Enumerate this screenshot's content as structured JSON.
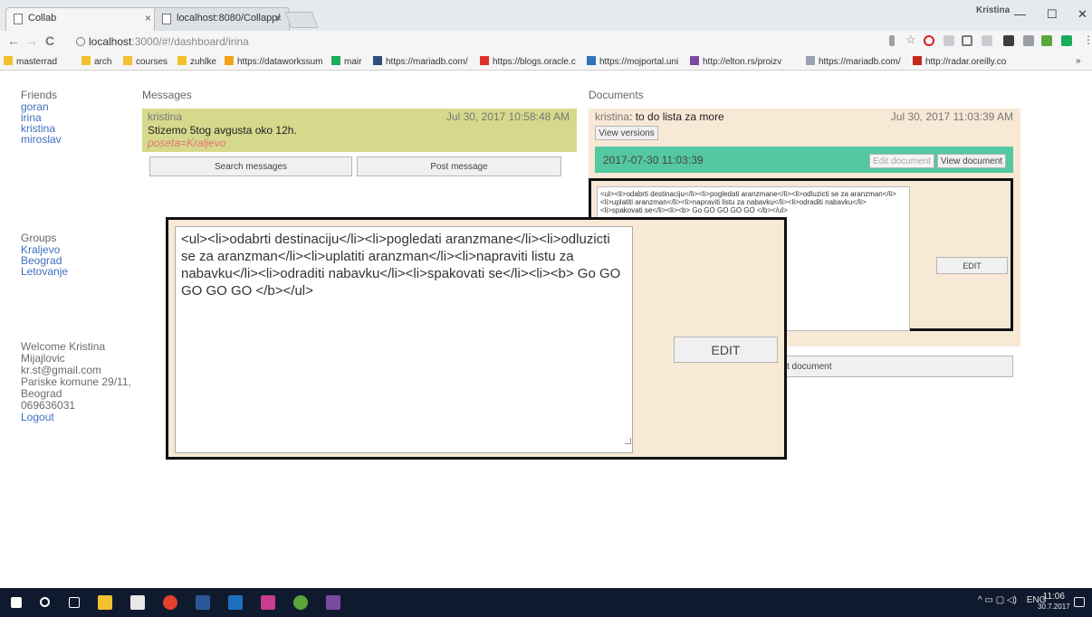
{
  "browser": {
    "tabs": [
      {
        "title": "Collab",
        "close": "×"
      },
      {
        "title": "localhost:8080/Collapp/",
        "close": "×"
      }
    ],
    "profile": "Kristina",
    "window_controls": {
      "minimize": "—",
      "maximize": "☐",
      "close": "✕"
    },
    "nav": {
      "back": "←",
      "forward": "→",
      "reload": "C"
    },
    "url": {
      "host": "localhost",
      "path": ":3000/#!/dashboard/irina"
    },
    "bookmarks": [
      {
        "label": "masterrad",
        "icon": "folder-icon",
        "color": "#f2c12e"
      },
      {
        "label": "arch",
        "icon": "folder-icon",
        "color": "#f2c12e"
      },
      {
        "label": "courses",
        "icon": "folder-icon",
        "color": "#f2c12e"
      },
      {
        "label": "zuhlke",
        "icon": "folder-icon",
        "color": "#f2c12e"
      },
      {
        "label": "https://dataworkssum",
        "icon": "page-icon",
        "color": "#f2a417"
      },
      {
        "label": "mair",
        "icon": "page-icon",
        "color": "#1aab5d"
      },
      {
        "label": "https://mariadb.com/",
        "icon": "page-icon",
        "color": "#2f4f7f"
      },
      {
        "label": "https://blogs.oracle.c",
        "icon": "page-icon",
        "color": "#e0302a"
      },
      {
        "label": "https://mojportal.uni",
        "icon": "page-icon",
        "color": "#2f73b8"
      },
      {
        "label": "http://elton.rs/proizv",
        "icon": "page-icon",
        "color": "#7a4aa3"
      },
      {
        "label": "https://mariadb.com/",
        "icon": "page-icon",
        "color": "#9aa4b0"
      },
      {
        "label": "http://radar.oreilly.co",
        "icon": "page-icon",
        "color": "#c9281f"
      }
    ],
    "bookmarks_more": "»"
  },
  "sidebar": {
    "friends_title": "Friends",
    "friends": [
      "goran",
      "irina",
      "kristina",
      "miroslav"
    ],
    "groups_title": "Groups",
    "groups": [
      "Kraljevo",
      "Beograd",
      "Letovanje"
    ],
    "welcome": [
      "Welcome Kristina",
      "Mijajlovic",
      "kr.st@gmail.com",
      "Pariske komune 29/11,",
      "Beograd",
      "069636031"
    ],
    "logout": "Logout"
  },
  "messages": {
    "title": "Messages",
    "items": [
      {
        "author": "kristina",
        "time": "Jul 30, 2017 10:58:48 AM",
        "text": "Stizemo 5tog avgusta oko 12h.",
        "tag": "poseta=Kraljevo"
      }
    ],
    "search_button": "Search messages",
    "post_button": "Post message"
  },
  "documents": {
    "title": "Documents",
    "item": {
      "author": "kristina",
      "sep": ": ",
      "name": "to do lista za more",
      "time": "Jul 30, 2017 11:03:39 AM",
      "view_versions": "View versions",
      "version_time": "2017-07-30 11:03:39",
      "edit_document": "Edit document",
      "view_document": "View document",
      "content": "<ul><li>odabrti destinaciju</li><li>pogledati aranzmane</li><li>odluzicti se za aranzman</li><li>uplatiti aranzman</li><li>napraviti listu za nabavku</li><li>odraditi nabavku</li><li>spakovati se</li><li><b> Go GO GO GO GO </b></ul>",
      "edit_button": "EDIT"
    },
    "post_document": "Post document",
    "post_document_visible": "t document"
  },
  "zoom": {
    "content": "<ul><li>odabrti destinaciju</li><li>pogledati aranzmane</li><li>odluzicti se za aranzman</li><li>uplatiti aranzman</li><li>napraviti listu za nabavku</li><li>odraditi nabavku</li><li>spakovati se</li><li><b> Go GO GO GO GO </b></ul>",
    "edit_button": "EDIT"
  },
  "taskbar": {
    "lang": "ENG",
    "time": "11:06",
    "date": "30.7.2017"
  }
}
